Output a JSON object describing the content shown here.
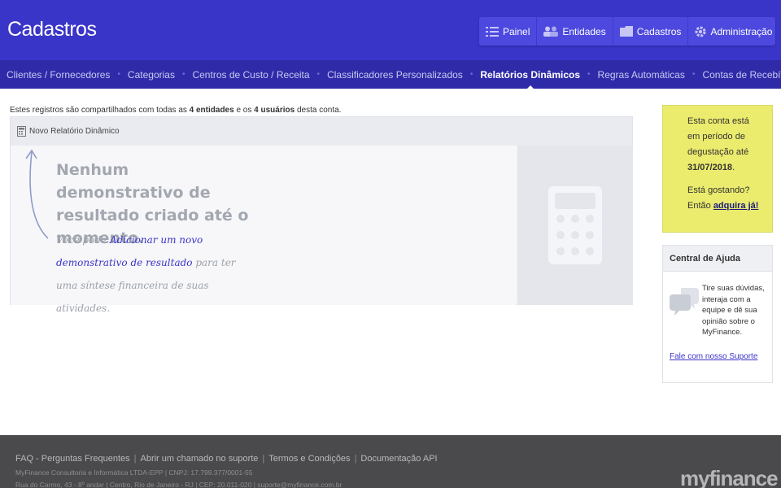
{
  "header": {
    "title": "Cadastros",
    "nav": [
      {
        "label": "Painel",
        "icon": "list-icon"
      },
      {
        "label": "Entidades",
        "icon": "users-icon"
      },
      {
        "label": "Cadastros",
        "icon": "folder-icon"
      },
      {
        "label": "Administração",
        "icon": "gear-icon"
      }
    ]
  },
  "subnav": {
    "items": [
      "Clientes / Fornecedores",
      "Categorias",
      "Centros de Custo / Receita",
      "Classificadores Personalizados",
      "Relatórios Dinâmicos",
      "Regras Automáticas",
      "Contas de Recebíveis"
    ],
    "active": "Relatórios Dinâmicos"
  },
  "main": {
    "share_note": {
      "prefix": "Estes registros são compartilhados com todas as ",
      "entities": "4 entidades",
      "middle": " e os ",
      "users": "4 usuários",
      "suffix": " desta conta."
    },
    "panel": {
      "new_label": "Novo Relatório Dinâmico",
      "empty_title": "Nenhum demonstrativo de resultado criado até o momento.",
      "empty_sub_prefix": "Você pode ",
      "empty_sub_link": "Adicionar um novo demonstrativo de resultado",
      "empty_sub_suffix": " para ter uma síntese financeira de suas atividades."
    }
  },
  "trial": {
    "line1": "Esta conta está em período de degustação até ",
    "date": "31/07/2018",
    "line1_end": ".",
    "line2": "Está gostando? Então ",
    "link": "adquira já!"
  },
  "help": {
    "title": "Central de Ajuda",
    "text": "Tire suas dúvidas, interaja com a equipe e dê sua opinião sobre o MyFinance.",
    "link": "Fale com nosso Suporte"
  },
  "footer": {
    "links": [
      "FAQ - Perguntas Frequentes",
      "Abrir um chamado no suporte",
      "Termos e Condições",
      "Documentação API"
    ],
    "separator": "|",
    "company": "MyFinance Consultoria e Informática LTDA-EPP | CNPJ: 17.799.377/0001-55",
    "address": "Rua do Carmo, 43 - 8º andar | Centro, Rio de Janeiro - RJ | CEP: 20.011-020 | suporte@myfinance.com.br",
    "brand": "myfinance"
  },
  "colors": {
    "header": "#3a35c9",
    "subnav": "#2f2ba8",
    "trial_bg": "#ebeb6e",
    "footer": "#4a4a4c"
  }
}
